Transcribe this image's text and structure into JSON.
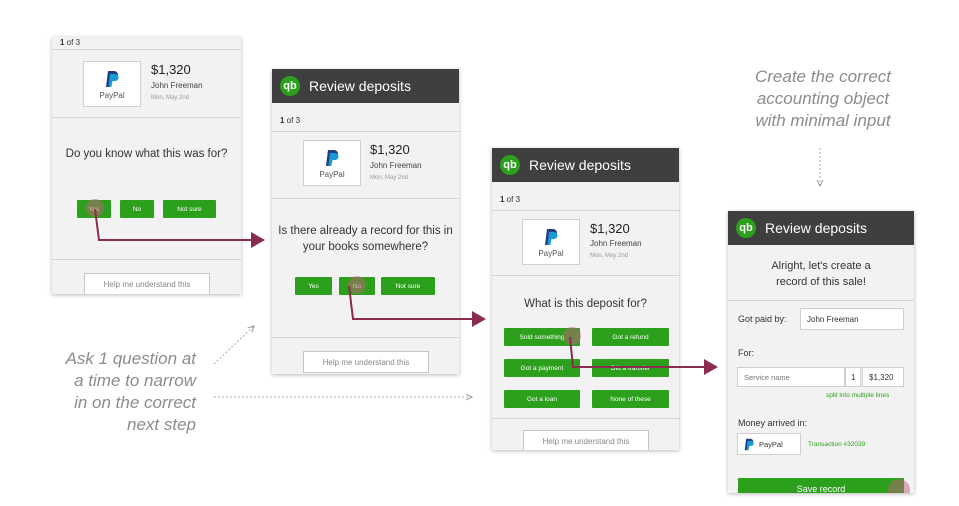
{
  "annotations": {
    "top_right": [
      "Create the correct",
      "accounting object",
      "with minimal input"
    ],
    "left": [
      "Ask 1 question at",
      "a time to narrow",
      "in on the correct",
      "next step"
    ]
  },
  "screen1": {
    "counter_num": "1",
    "counter_rest": " of 3",
    "amount": "$1,320",
    "name": "John Freeman",
    "date": "Mon, May 2nd",
    "payment_label": "PayPal",
    "question": "Do you know what this was for?",
    "buttons": [
      "Yes",
      "No",
      "Not sure"
    ],
    "help": "Help me understand this"
  },
  "screen2": {
    "title": "Review deposits",
    "counter_num": "1",
    "counter_rest": " of 3",
    "amount": "$1,320",
    "name": "John Freeman",
    "date": "Mon, May 2nd",
    "payment_label": "PayPal",
    "question_line1": "Is there already a record for this in",
    "question_line2": "your books somewhere?",
    "buttons": [
      "Yes",
      "No",
      "Not sure"
    ],
    "help": "Help me understand this"
  },
  "screen3": {
    "title": "Review deposits",
    "counter_num": "1",
    "counter_rest": " of 3",
    "amount": "$1,320",
    "name": "John Freeman",
    "date": "Mon, May 2nd",
    "payment_label": "PayPal",
    "question": "What is this deposit for?",
    "buttons": [
      "Sold something",
      "Got a refund",
      "Got a payment",
      "Did a transfer",
      "Got a loan",
      "None of these"
    ],
    "help": "Help me understand this"
  },
  "screen4": {
    "title": "Review deposits",
    "heading_line1": "Alright, let's create a",
    "heading_line2": "record of this sale!",
    "got_paid_label": "Got paid by:",
    "got_paid_value": "John Freeman",
    "for_label": "For:",
    "service_placeholder": "Service name",
    "quantity": "1",
    "line_amount": "$1,320",
    "split_link": "split into multiple lines",
    "money_arrived_label": "Money arrived in:",
    "payment_label": "PayPal",
    "transaction": "Transaction #32039",
    "save_button": "Save record"
  },
  "colors": {
    "brand_green": "#2ca01c",
    "header_dark": "#3f3f3f",
    "flow_arrow": "#8b2c4c",
    "annotation_gray": "#8c8c8c"
  },
  "icons": {
    "logo": "quickbooks-logo-icon",
    "payment": "paypal-logo-icon"
  }
}
